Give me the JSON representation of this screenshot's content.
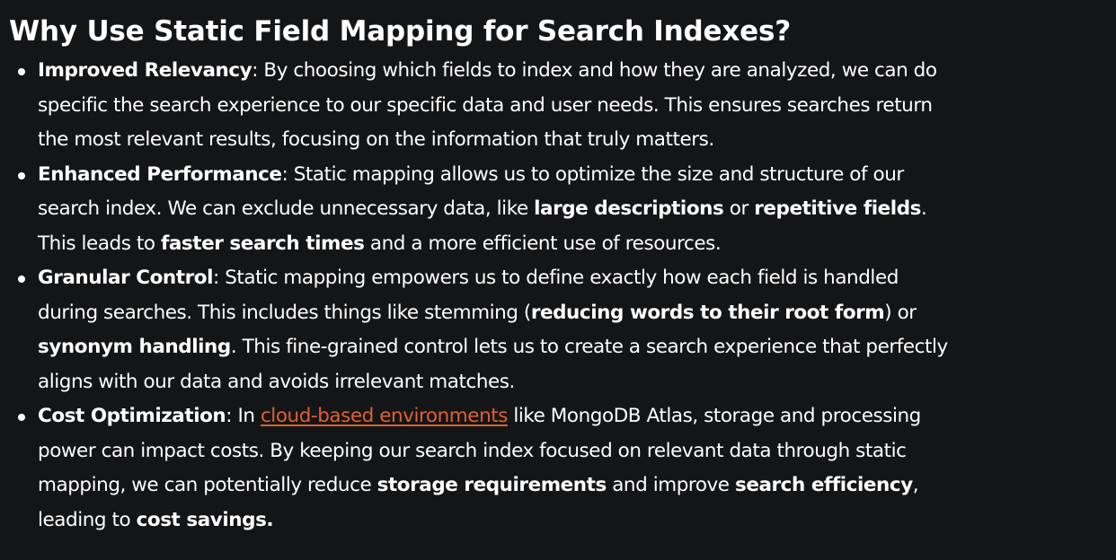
{
  "heading": "Why Use Static Field Mapping for Search Indexes?",
  "colors": {
    "background": "#141517",
    "text": "#ffffff",
    "link": "#e0622f"
  },
  "items": [
    {
      "title": "Improved Relevancy",
      "sep": ": ",
      "t1": "By choosing which fields to index and how they are analyzed, we can do specific the search experience to our specific data and user needs. This ensures searches return the most relevant results, focusing on the information that truly matters."
    },
    {
      "title": "Enhanced Performance",
      "sep": ": ",
      "t1": "Static mapping allows us to optimize the size and structure of our search index. We can exclude unnecessary data, like ",
      "b1": "large descriptions",
      "t2": " or ",
      "b2": "repetitive fields",
      "t3": ". This leads to ",
      "b3": "faster search times",
      "t4": " and a more efficient use of resources."
    },
    {
      "title": "Granular Control",
      "sep": ": ",
      "t1": "Static mapping empowers us to define exactly how each field is handled during searches. This includes things like stemming (",
      "b1": "reducing words to their root form",
      "t2": ") or ",
      "b2": "synonym handling",
      "t3": ". This fine-grained control lets us to create a search experience that perfectly aligns with our data and avoids irrelevant matches."
    },
    {
      "title": "Cost Optimization",
      "sep": ": ",
      "t1": "In ",
      "link": "cloud-based environments",
      "t2": " like MongoDB Atlas, storage and processing power can impact costs. By keeping our search index focused on relevant data through static mapping, we can potentially reduce ",
      "b1": "storage requirements",
      "t3": " and improve ",
      "b2": "search efficiency",
      "t4": ", leading to ",
      "b3": "cost savings."
    }
  ]
}
